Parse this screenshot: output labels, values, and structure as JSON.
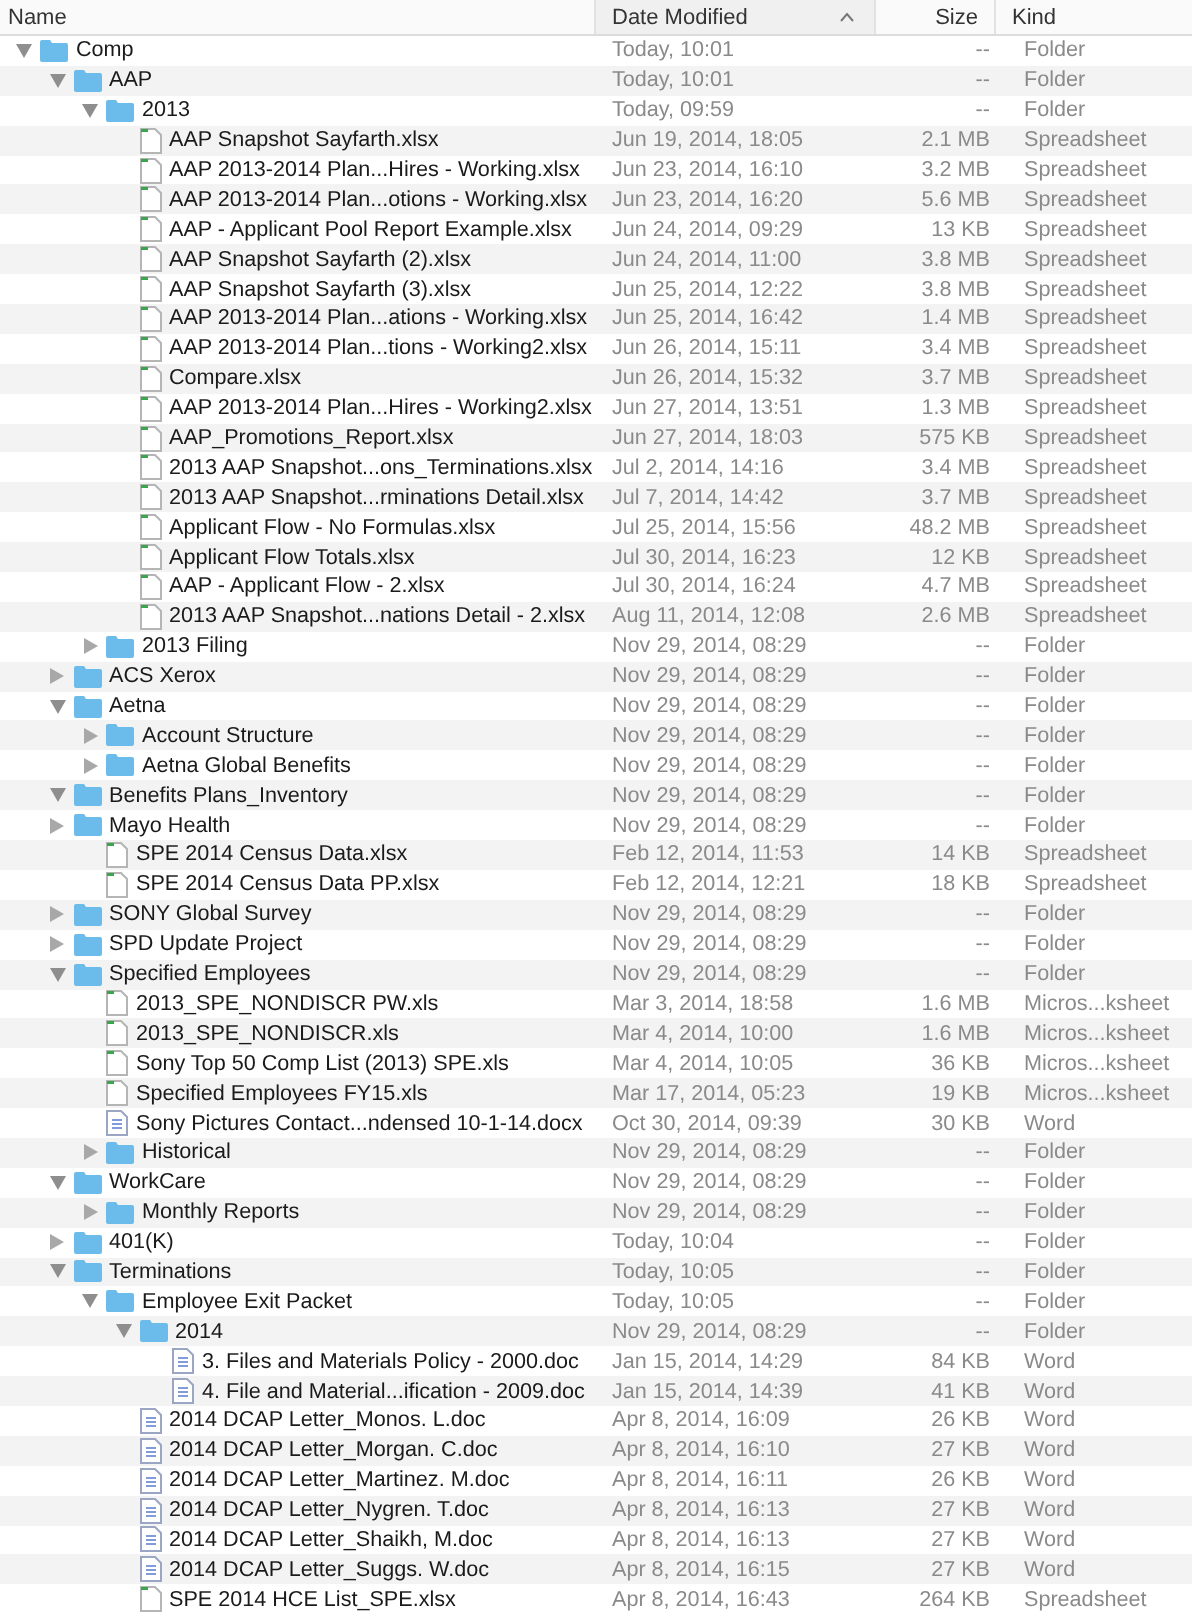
{
  "columns": [
    {
      "label": "Name",
      "sorted": false
    },
    {
      "label": "Date Modified",
      "sorted": true
    },
    {
      "label": "Size",
      "sorted": false
    },
    {
      "label": "Kind",
      "sorted": false
    }
  ],
  "items": [
    {
      "kind": "folder",
      "name": "Comp",
      "date": "Today, 10:01",
      "size": "--",
      "type": "Folder",
      "expanded": true,
      "children": [
        {
          "kind": "folder",
          "name": "AAP",
          "date": "Today, 10:01",
          "size": "--",
          "type": "Folder",
          "expanded": true,
          "children": [
            {
              "kind": "folder",
              "name": "2013",
              "date": "Today, 09:59",
              "size": "--",
              "type": "Folder",
              "expanded": true,
              "children": [
                {
                  "kind": "spreadsheet",
                  "name": "AAP Snapshot Sayfarth.xlsx",
                  "date": "Jun 19, 2014, 18:05",
                  "size": "2.1 MB",
                  "type": "Spreadsheet"
                },
                {
                  "kind": "spreadsheet",
                  "name": "AAP 2013-2014 Plan...Hires - Working.xlsx",
                  "date": "Jun 23, 2014, 16:10",
                  "size": "3.2 MB",
                  "type": "Spreadsheet"
                },
                {
                  "kind": "spreadsheet",
                  "name": "AAP 2013-2014 Plan...otions - Working.xlsx",
                  "date": "Jun 23, 2014, 16:20",
                  "size": "5.6 MB",
                  "type": "Spreadsheet"
                },
                {
                  "kind": "spreadsheet",
                  "name": "AAP - Applicant Pool Report Example.xlsx",
                  "date": "Jun 24, 2014, 09:29",
                  "size": "13 KB",
                  "type": "Spreadsheet"
                },
                {
                  "kind": "spreadsheet",
                  "name": "AAP Snapshot Sayfarth (2).xlsx",
                  "date": "Jun 24, 2014, 11:00",
                  "size": "3.8 MB",
                  "type": "Spreadsheet"
                },
                {
                  "kind": "spreadsheet",
                  "name": "AAP Snapshot Sayfarth (3).xlsx",
                  "date": "Jun 25, 2014, 12:22",
                  "size": "3.8 MB",
                  "type": "Spreadsheet"
                },
                {
                  "kind": "spreadsheet",
                  "name": "AAP 2013-2014 Plan...ations - Working.xlsx",
                  "date": "Jun 25, 2014, 16:42",
                  "size": "1.4 MB",
                  "type": "Spreadsheet"
                },
                {
                  "kind": "spreadsheet",
                  "name": "AAP 2013-2014 Plan...tions - Working2.xlsx",
                  "date": "Jun 26, 2014, 15:11",
                  "size": "3.4 MB",
                  "type": "Spreadsheet"
                },
                {
                  "kind": "spreadsheet",
                  "name": "Compare.xlsx",
                  "date": "Jun 26, 2014, 15:32",
                  "size": "3.7 MB",
                  "type": "Spreadsheet"
                },
                {
                  "kind": "spreadsheet",
                  "name": "AAP 2013-2014 Plan...Hires - Working2.xlsx",
                  "date": "Jun 27, 2014, 13:51",
                  "size": "1.3 MB",
                  "type": "Spreadsheet"
                },
                {
                  "kind": "spreadsheet",
                  "name": "AAP_Promotions_Report.xlsx",
                  "date": "Jun 27, 2014, 18:03",
                  "size": "575 KB",
                  "type": "Spreadsheet"
                },
                {
                  "kind": "spreadsheet",
                  "name": "2013 AAP Snapshot...ons_Terminations.xlsx",
                  "date": "Jul 2, 2014, 14:16",
                  "size": "3.4 MB",
                  "type": "Spreadsheet"
                },
                {
                  "kind": "spreadsheet",
                  "name": "2013 AAP Snapshot...rminations Detail.xlsx",
                  "date": "Jul 7, 2014, 14:42",
                  "size": "3.7 MB",
                  "type": "Spreadsheet"
                },
                {
                  "kind": "spreadsheet",
                  "name": "Applicant Flow - No Formulas.xlsx",
                  "date": "Jul 25, 2014, 15:56",
                  "size": "48.2 MB",
                  "type": "Spreadsheet"
                },
                {
                  "kind": "spreadsheet",
                  "name": "Applicant Flow Totals.xlsx",
                  "date": "Jul 30, 2014, 16:23",
                  "size": "12 KB",
                  "type": "Spreadsheet"
                },
                {
                  "kind": "spreadsheet",
                  "name": "AAP - Applicant Flow - 2.xlsx",
                  "date": "Jul 30, 2014, 16:24",
                  "size": "4.7 MB",
                  "type": "Spreadsheet"
                },
                {
                  "kind": "spreadsheet",
                  "name": "2013 AAP Snapshot...nations Detail - 2.xlsx",
                  "date": "Aug 11, 2014, 12:08",
                  "size": "2.6 MB",
                  "type": "Spreadsheet"
                }
              ]
            },
            {
              "kind": "folder",
              "name": "2013 Filing",
              "date": "Nov 29, 2014, 08:29",
              "size": "--",
              "type": "Folder",
              "expanded": false
            }
          ]
        },
        {
          "kind": "folder",
          "name": "ACS Xerox",
          "date": "Nov 29, 2014, 08:29",
          "size": "--",
          "type": "Folder",
          "expanded": false
        },
        {
          "kind": "folder",
          "name": "Aetna",
          "date": "Nov 29, 2014, 08:29",
          "size": "--",
          "type": "Folder",
          "expanded": true,
          "children": [
            {
              "kind": "folder",
              "name": "Account Structure",
              "date": "Nov 29, 2014, 08:29",
              "size": "--",
              "type": "Folder",
              "expanded": false
            },
            {
              "kind": "folder",
              "name": "Aetna Global Benefits",
              "date": "Nov 29, 2014, 08:29",
              "size": "--",
              "type": "Folder",
              "expanded": false
            }
          ]
        },
        {
          "kind": "folder",
          "name": "Benefits Plans_Inventory",
          "date": "Nov 29, 2014, 08:29",
          "size": "--",
          "type": "Folder",
          "expanded": true
        },
        {
          "kind": "folder",
          "name": "Mayo Health",
          "date": "Nov 29, 2014, 08:29",
          "size": "--",
          "type": "Folder",
          "expanded": false,
          "children": [
            {
              "kind": "spreadsheet",
              "name": "SPE 2014 Census Data.xlsx",
              "date": "Feb 12, 2014, 11:53",
              "size": "14 KB",
              "type": "Spreadsheet"
            },
            {
              "kind": "spreadsheet",
              "name": "SPE 2014 Census Data PP.xlsx",
              "date": "Feb 12, 2014, 12:21",
              "size": "18 KB",
              "type": "Spreadsheet"
            }
          ]
        },
        {
          "kind": "folder",
          "name": "SONY Global Survey",
          "date": "Nov 29, 2014, 08:29",
          "size": "--",
          "type": "Folder",
          "expanded": false
        },
        {
          "kind": "folder",
          "name": "SPD Update Project",
          "date": "Nov 29, 2014, 08:29",
          "size": "--",
          "type": "Folder",
          "expanded": false
        },
        {
          "kind": "folder",
          "name": "Specified Employees",
          "date": "Nov 29, 2014, 08:29",
          "size": "--",
          "type": "Folder",
          "expanded": true,
          "children": [
            {
              "kind": "spreadsheet",
              "name": "2013_SPE_NONDISCR PW.xls",
              "date": "Mar 3, 2014, 18:58",
              "size": "1.6 MB",
              "type": "Micros...ksheet"
            },
            {
              "kind": "spreadsheet",
              "name": "2013_SPE_NONDISCR.xls",
              "date": "Mar 4, 2014, 10:00",
              "size": "1.6 MB",
              "type": "Micros...ksheet"
            },
            {
              "kind": "spreadsheet",
              "name": "Sony Top 50 Comp List (2013) SPE.xls",
              "date": "Mar 4, 2014, 10:05",
              "size": "36 KB",
              "type": "Micros...ksheet"
            },
            {
              "kind": "spreadsheet",
              "name": "Specified Employees FY15.xls",
              "date": "Mar 17, 2014, 05:23",
              "size": "19 KB",
              "type": "Micros...ksheet"
            },
            {
              "kind": "word",
              "name": "Sony Pictures Contact...ndensed 10-1-14.docx",
              "date": "Oct 30, 2014, 09:39",
              "size": "30 KB",
              "type": "Word"
            },
            {
              "kind": "folder",
              "name": "Historical",
              "date": "Nov 29, 2014, 08:29",
              "size": "--",
              "type": "Folder",
              "expanded": false
            }
          ]
        },
        {
          "kind": "folder",
          "name": "WorkCare",
          "date": "Nov 29, 2014, 08:29",
          "size": "--",
          "type": "Folder",
          "expanded": true,
          "children": [
            {
              "kind": "folder",
              "name": "Monthly Reports",
              "date": "Nov 29, 2014, 08:29",
              "size": "--",
              "type": "Folder",
              "expanded": false
            }
          ]
        },
        {
          "kind": "folder",
          "name": "401(K)",
          "date": "Today, 10:04",
          "size": "--",
          "type": "Folder",
          "expanded": false
        },
        {
          "kind": "folder",
          "name": "Terminations",
          "date": "Today, 10:05",
          "size": "--",
          "type": "Folder",
          "expanded": true,
          "children": [
            {
              "kind": "folder",
              "name": "Employee Exit Packet",
              "date": "Today, 10:05",
              "size": "--",
              "type": "Folder",
              "expanded": true,
              "children": [
                {
                  "kind": "folder",
                  "name": "2014",
                  "date": "Nov 29, 2014, 08:29",
                  "size": "--",
                  "type": "Folder",
                  "expanded": true,
                  "children": [
                    {
                      "kind": "word",
                      "name": "3. Files and Materials Policy - 2000.doc",
                      "date": "Jan 15, 2014, 14:29",
                      "size": "84 KB",
                      "type": "Word"
                    },
                    {
                      "kind": "word",
                      "name": "4. File and Material...ification - 2009.doc",
                      "date": "Jan 15, 2014, 14:39",
                      "size": "41 KB",
                      "type": "Word"
                    }
                  ]
                },
                {
                  "kind": "word",
                  "name": "2014 DCAP Letter_Monos. L.doc",
                  "date": "Apr 8, 2014, 16:09",
                  "size": "26 KB",
                  "type": "Word"
                },
                {
                  "kind": "word",
                  "name": "2014 DCAP Letter_Morgan. C.doc",
                  "date": "Apr 8, 2014, 16:10",
                  "size": "27 KB",
                  "type": "Word"
                },
                {
                  "kind": "word",
                  "name": "2014 DCAP Letter_Martinez. M.doc",
                  "date": "Apr 8, 2014, 16:11",
                  "size": "26 KB",
                  "type": "Word"
                },
                {
                  "kind": "word",
                  "name": "2014 DCAP Letter_Nygren. T.doc",
                  "date": "Apr 8, 2014, 16:13",
                  "size": "27 KB",
                  "type": "Word"
                },
                {
                  "kind": "word",
                  "name": "2014 DCAP Letter_Shaikh, M.doc",
                  "date": "Apr 8, 2014, 16:13",
                  "size": "27 KB",
                  "type": "Word"
                },
                {
                  "kind": "word",
                  "name": "2014 DCAP Letter_Suggs. W.doc",
                  "date": "Apr 8, 2014, 16:15",
                  "size": "27 KB",
                  "type": "Word"
                },
                {
                  "kind": "spreadsheet",
                  "name": "SPE 2014 HCE List_SPE.xlsx",
                  "date": "Apr 8, 2014, 16:43",
                  "size": "264 KB",
                  "type": "Spreadsheet"
                }
              ]
            }
          ]
        }
      ]
    }
  ]
}
